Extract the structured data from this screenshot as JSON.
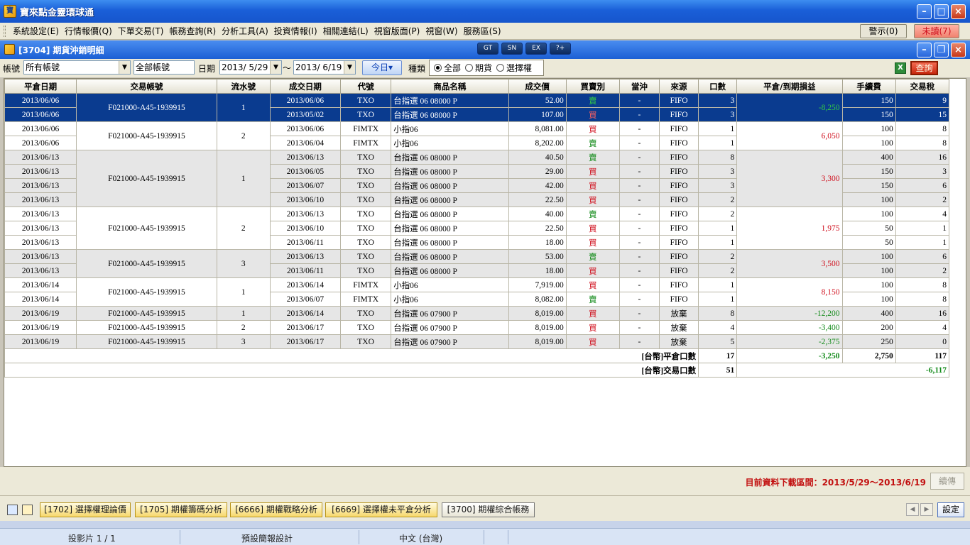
{
  "app": {
    "icon_text": "寶",
    "title": "寶來點金靈環球通"
  },
  "menu": {
    "items": [
      "系統設定(E)",
      "行情報價(Q)",
      "下單交易(T)",
      "帳務查詢(R)",
      "分析工具(A)",
      "投資情報(I)",
      "相關連結(L)",
      "視窗版面(P)",
      "視窗(W)",
      "服務區(S)"
    ],
    "alert": "警示(0)",
    "unread": "未讀(7)",
    "unread_color": "#d0101e"
  },
  "subwindow": {
    "title": "[3704] 期貨沖銷明細",
    "tools": [
      "GT",
      "SN",
      "EX",
      "?+"
    ]
  },
  "filter": {
    "account_label": "帳號",
    "account_value": "所有帳號",
    "account_all": "全部帳號",
    "date_label": "日期",
    "date_from": "2013/ 5/29",
    "date_sep": "～",
    "date_to": "2013/ 6/19",
    "today": "今日▾",
    "type_label": "種類",
    "types": [
      "全部",
      "期貨",
      "選擇權"
    ],
    "selected_type": "全部",
    "query": "查詢",
    "excel": "X"
  },
  "table": {
    "headers": [
      "平倉日期",
      "交易帳號",
      "流水號",
      "成交日期",
      "代號",
      "商品名稱",
      "成交價",
      "買賣別",
      "當沖",
      "來源",
      "口數",
      "平倉/到期損益",
      "手續費",
      "交易稅"
    ],
    "groups": [
      {
        "close": "2013/06/06",
        "account": "F021000-A45-1939915",
        "serial": "1",
        "pnl": "-8,250",
        "pnl_color": "green",
        "shade": "sel",
        "rows": [
          {
            "close": "2013/06/06",
            "date": "2013/06/06",
            "code": "TXO",
            "name": "台指選 06 08000 P",
            "price": "52.00",
            "side": "賣",
            "day": "-",
            "src": "FIFO",
            "qty": "3",
            "fee": "150",
            "tax": "9"
          },
          {
            "close": "2013/06/06",
            "date": "2013/05/02",
            "code": "TXO",
            "name": "台指選 06 08000 P",
            "price": "107.00",
            "side": "買",
            "day": "-",
            "src": "FIFO",
            "qty": "3",
            "fee": "150",
            "tax": "15"
          }
        ]
      },
      {
        "close": "2013/06/06",
        "account": "F021000-A45-1939915",
        "serial": "2",
        "pnl": "6,050",
        "pnl_color": "red",
        "shade": "w",
        "rows": [
          {
            "close": "2013/06/06",
            "date": "2013/06/06",
            "code": "FIMTX",
            "name": "小指06",
            "price": "8,081.00",
            "side": "買",
            "day": "-",
            "src": "FIFO",
            "qty": "1",
            "fee": "100",
            "tax": "8"
          },
          {
            "close": "2013/06/06",
            "date": "2013/06/04",
            "code": "FIMTX",
            "name": "小指06",
            "price": "8,202.00",
            "side": "賣",
            "day": "-",
            "src": "FIFO",
            "qty": "1",
            "fee": "100",
            "tax": "8"
          }
        ]
      },
      {
        "close": "2013/06/13",
        "account": "F021000-A45-1939915",
        "serial": "1",
        "pnl": "3,300",
        "pnl_color": "red",
        "shade": "g",
        "rows": [
          {
            "close": "2013/06/13",
            "date": "2013/06/13",
            "code": "TXO",
            "name": "台指選 06 08000 P",
            "price": "40.50",
            "side": "賣",
            "day": "-",
            "src": "FIFO",
            "qty": "8",
            "fee": "400",
            "tax": "16"
          },
          {
            "close": "2013/06/13",
            "date": "2013/06/05",
            "code": "TXO",
            "name": "台指選 06 08000 P",
            "price": "29.00",
            "side": "買",
            "day": "-",
            "src": "FIFO",
            "qty": "3",
            "fee": "150",
            "tax": "3"
          },
          {
            "close": "2013/06/13",
            "date": "2013/06/07",
            "code": "TXO",
            "name": "台指選 06 08000 P",
            "price": "42.00",
            "side": "買",
            "day": "-",
            "src": "FIFO",
            "qty": "3",
            "fee": "150",
            "tax": "6"
          },
          {
            "close": "2013/06/13",
            "date": "2013/06/10",
            "code": "TXO",
            "name": "台指選 06 08000 P",
            "price": "22.50",
            "side": "買",
            "day": "-",
            "src": "FIFO",
            "qty": "2",
            "fee": "100",
            "tax": "2"
          }
        ]
      },
      {
        "close": "2013/06/13",
        "account": "F021000-A45-1939915",
        "serial": "2",
        "pnl": "1,975",
        "pnl_color": "red",
        "shade": "w",
        "rows": [
          {
            "close": "2013/06/13",
            "date": "2013/06/13",
            "code": "TXO",
            "name": "台指選 06 08000 P",
            "price": "40.00",
            "side": "賣",
            "day": "-",
            "src": "FIFO",
            "qty": "2",
            "fee": "100",
            "tax": "4"
          },
          {
            "close": "2013/06/13",
            "date": "2013/06/10",
            "code": "TXO",
            "name": "台指選 06 08000 P",
            "price": "22.50",
            "side": "買",
            "day": "-",
            "src": "FIFO",
            "qty": "1",
            "fee": "50",
            "tax": "1"
          },
          {
            "close": "2013/06/13",
            "date": "2013/06/11",
            "code": "TXO",
            "name": "台指選 06 08000 P",
            "price": "18.00",
            "side": "買",
            "day": "-",
            "src": "FIFO",
            "qty": "1",
            "fee": "50",
            "tax": "1"
          }
        ]
      },
      {
        "close": "2013/06/13",
        "account": "F021000-A45-1939915",
        "serial": "3",
        "pnl": "3,500",
        "pnl_color": "red",
        "shade": "g",
        "rows": [
          {
            "close": "2013/06/13",
            "date": "2013/06/13",
            "code": "TXO",
            "name": "台指選 06 08000 P",
            "price": "53.00",
            "side": "賣",
            "day": "-",
            "src": "FIFO",
            "qty": "2",
            "fee": "100",
            "tax": "6"
          },
          {
            "close": "2013/06/13",
            "date": "2013/06/11",
            "code": "TXO",
            "name": "台指選 06 08000 P",
            "price": "18.00",
            "side": "買",
            "day": "-",
            "src": "FIFO",
            "qty": "2",
            "fee": "100",
            "tax": "2"
          }
        ]
      },
      {
        "close": "2013/06/14",
        "account": "F021000-A45-1939915",
        "serial": "1",
        "pnl": "8,150",
        "pnl_color": "red",
        "shade": "w",
        "rows": [
          {
            "close": "2013/06/14",
            "date": "2013/06/14",
            "code": "FIMTX",
            "name": "小指06",
            "price": "7,919.00",
            "side": "買",
            "day": "-",
            "src": "FIFO",
            "qty": "1",
            "fee": "100",
            "tax": "8"
          },
          {
            "close": "2013/06/14",
            "date": "2013/06/07",
            "code": "FIMTX",
            "name": "小指06",
            "price": "8,082.00",
            "side": "賣",
            "day": "-",
            "src": "FIFO",
            "qty": "1",
            "fee": "100",
            "tax": "8"
          }
        ]
      },
      {
        "close": "2013/06/19",
        "account": "F021000-A45-1939915",
        "serial": "1",
        "pnl": "-12,200",
        "pnl_color": "green",
        "shade": "g",
        "rows": [
          {
            "close": "2013/06/19",
            "date": "2013/06/14",
            "code": "TXO",
            "name": "台指選 06 07900 P",
            "price": "8,019.00",
            "side": "買",
            "day": "-",
            "src": "放棄",
            "qty": "8",
            "fee": "400",
            "tax": "16"
          }
        ]
      },
      {
        "close": "2013/06/19",
        "account": "F021000-A45-1939915",
        "serial": "2",
        "pnl": "-3,400",
        "pnl_color": "green",
        "shade": "w",
        "rows": [
          {
            "close": "2013/06/19",
            "date": "2013/06/17",
            "code": "TXO",
            "name": "台指選 06 07900 P",
            "price": "8,019.00",
            "side": "買",
            "day": "-",
            "src": "放棄",
            "qty": "4",
            "fee": "200",
            "tax": "4"
          }
        ]
      },
      {
        "close": "2013/06/19",
        "account": "F021000-A45-1939915",
        "serial": "3",
        "pnl": "-2,375",
        "pnl_color": "green",
        "shade": "g",
        "rows": [
          {
            "close": "2013/06/19",
            "date": "2013/06/17",
            "code": "TXO",
            "name": "台指選 06 07900 P",
            "price": "8,019.00",
            "side": "買",
            "day": "-",
            "src": "放棄",
            "qty": "5",
            "fee": "250",
            "tax": "0"
          }
        ]
      }
    ],
    "totals": {
      "close_label": "[台幣]平倉口數",
      "close_qty": "17",
      "close_pnl": "-3,250",
      "close_fee": "2,750",
      "close_tax": "117",
      "trade_label": "[台幣]交易口數",
      "trade_qty": "51",
      "trade_net": "-6,117"
    }
  },
  "status": {
    "download_range": "目前資料下載區間：2013/5/29～2013/6/19",
    "continue": "續傳"
  },
  "taskbar": {
    "tasks": [
      "[1702] 選擇權理論價",
      "[1705] 期權籌碼分析",
      "[6666] 期權戰略分析",
      "[6669] 選擇權未平倉分析",
      "[3700] 期權綜合帳務"
    ],
    "active": "[3700] 期權綜合帳務",
    "settings": "設定"
  },
  "ppt_status": {
    "slide": "投影片 1 / 1",
    "design": "預設簡報設計",
    "lang": "中文 (台灣)"
  }
}
